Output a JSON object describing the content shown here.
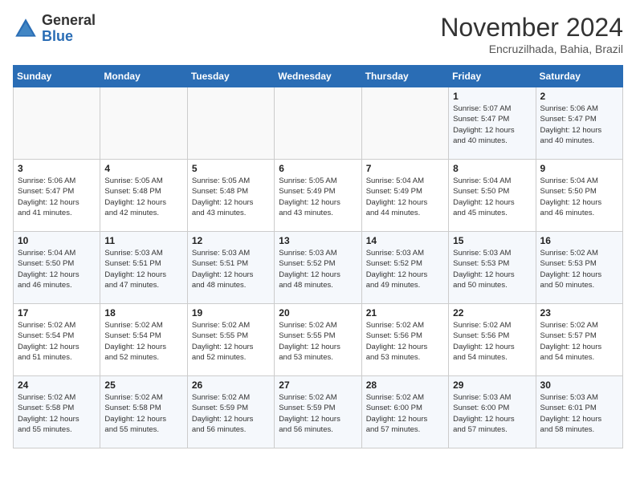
{
  "header": {
    "logo_line1": "General",
    "logo_line2": "Blue",
    "month": "November 2024",
    "location": "Encruzilhada, Bahia, Brazil"
  },
  "days_of_week": [
    "Sunday",
    "Monday",
    "Tuesday",
    "Wednesday",
    "Thursday",
    "Friday",
    "Saturday"
  ],
  "weeks": [
    [
      {
        "day": "",
        "info": ""
      },
      {
        "day": "",
        "info": ""
      },
      {
        "day": "",
        "info": ""
      },
      {
        "day": "",
        "info": ""
      },
      {
        "day": "",
        "info": ""
      },
      {
        "day": "1",
        "info": "Sunrise: 5:07 AM\nSunset: 5:47 PM\nDaylight: 12 hours\nand 40 minutes."
      },
      {
        "day": "2",
        "info": "Sunrise: 5:06 AM\nSunset: 5:47 PM\nDaylight: 12 hours\nand 40 minutes."
      }
    ],
    [
      {
        "day": "3",
        "info": "Sunrise: 5:06 AM\nSunset: 5:47 PM\nDaylight: 12 hours\nand 41 minutes."
      },
      {
        "day": "4",
        "info": "Sunrise: 5:05 AM\nSunset: 5:48 PM\nDaylight: 12 hours\nand 42 minutes."
      },
      {
        "day": "5",
        "info": "Sunrise: 5:05 AM\nSunset: 5:48 PM\nDaylight: 12 hours\nand 43 minutes."
      },
      {
        "day": "6",
        "info": "Sunrise: 5:05 AM\nSunset: 5:49 PM\nDaylight: 12 hours\nand 43 minutes."
      },
      {
        "day": "7",
        "info": "Sunrise: 5:04 AM\nSunset: 5:49 PM\nDaylight: 12 hours\nand 44 minutes."
      },
      {
        "day": "8",
        "info": "Sunrise: 5:04 AM\nSunset: 5:50 PM\nDaylight: 12 hours\nand 45 minutes."
      },
      {
        "day": "9",
        "info": "Sunrise: 5:04 AM\nSunset: 5:50 PM\nDaylight: 12 hours\nand 46 minutes."
      }
    ],
    [
      {
        "day": "10",
        "info": "Sunrise: 5:04 AM\nSunset: 5:50 PM\nDaylight: 12 hours\nand 46 minutes."
      },
      {
        "day": "11",
        "info": "Sunrise: 5:03 AM\nSunset: 5:51 PM\nDaylight: 12 hours\nand 47 minutes."
      },
      {
        "day": "12",
        "info": "Sunrise: 5:03 AM\nSunset: 5:51 PM\nDaylight: 12 hours\nand 48 minutes."
      },
      {
        "day": "13",
        "info": "Sunrise: 5:03 AM\nSunset: 5:52 PM\nDaylight: 12 hours\nand 48 minutes."
      },
      {
        "day": "14",
        "info": "Sunrise: 5:03 AM\nSunset: 5:52 PM\nDaylight: 12 hours\nand 49 minutes."
      },
      {
        "day": "15",
        "info": "Sunrise: 5:03 AM\nSunset: 5:53 PM\nDaylight: 12 hours\nand 50 minutes."
      },
      {
        "day": "16",
        "info": "Sunrise: 5:02 AM\nSunset: 5:53 PM\nDaylight: 12 hours\nand 50 minutes."
      }
    ],
    [
      {
        "day": "17",
        "info": "Sunrise: 5:02 AM\nSunset: 5:54 PM\nDaylight: 12 hours\nand 51 minutes."
      },
      {
        "day": "18",
        "info": "Sunrise: 5:02 AM\nSunset: 5:54 PM\nDaylight: 12 hours\nand 52 minutes."
      },
      {
        "day": "19",
        "info": "Sunrise: 5:02 AM\nSunset: 5:55 PM\nDaylight: 12 hours\nand 52 minutes."
      },
      {
        "day": "20",
        "info": "Sunrise: 5:02 AM\nSunset: 5:55 PM\nDaylight: 12 hours\nand 53 minutes."
      },
      {
        "day": "21",
        "info": "Sunrise: 5:02 AM\nSunset: 5:56 PM\nDaylight: 12 hours\nand 53 minutes."
      },
      {
        "day": "22",
        "info": "Sunrise: 5:02 AM\nSunset: 5:56 PM\nDaylight: 12 hours\nand 54 minutes."
      },
      {
        "day": "23",
        "info": "Sunrise: 5:02 AM\nSunset: 5:57 PM\nDaylight: 12 hours\nand 54 minutes."
      }
    ],
    [
      {
        "day": "24",
        "info": "Sunrise: 5:02 AM\nSunset: 5:58 PM\nDaylight: 12 hours\nand 55 minutes."
      },
      {
        "day": "25",
        "info": "Sunrise: 5:02 AM\nSunset: 5:58 PM\nDaylight: 12 hours\nand 55 minutes."
      },
      {
        "day": "26",
        "info": "Sunrise: 5:02 AM\nSunset: 5:59 PM\nDaylight: 12 hours\nand 56 minutes."
      },
      {
        "day": "27",
        "info": "Sunrise: 5:02 AM\nSunset: 5:59 PM\nDaylight: 12 hours\nand 56 minutes."
      },
      {
        "day": "28",
        "info": "Sunrise: 5:02 AM\nSunset: 6:00 PM\nDaylight: 12 hours\nand 57 minutes."
      },
      {
        "day": "29",
        "info": "Sunrise: 5:03 AM\nSunset: 6:00 PM\nDaylight: 12 hours\nand 57 minutes."
      },
      {
        "day": "30",
        "info": "Sunrise: 5:03 AM\nSunset: 6:01 PM\nDaylight: 12 hours\nand 58 minutes."
      }
    ]
  ]
}
